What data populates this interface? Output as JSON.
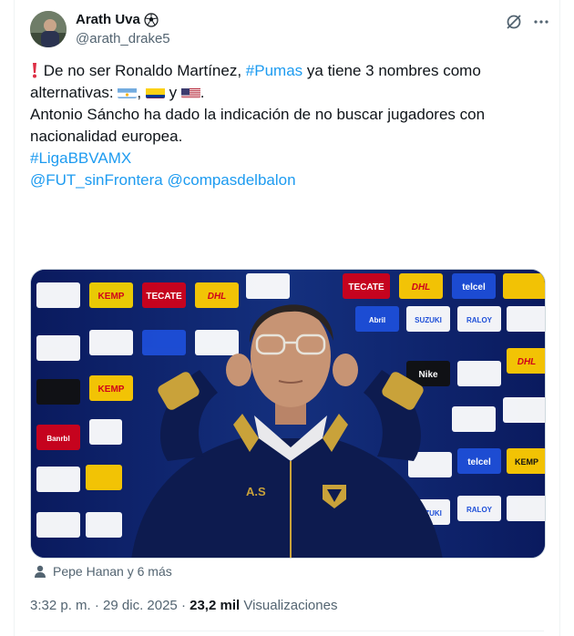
{
  "author": {
    "name": "Arath Uva",
    "handle": "@arath_drake5",
    "badge_icon": "soccer-ball-icon"
  },
  "header_icons": [
    "grok-icon",
    "more-icon"
  ],
  "tweet": {
    "line1_pre": "De no ser Ronaldo Martínez, ",
    "line1_hashtag": "#Pumas",
    "line1_post": " ya tiene 3 nombres como",
    "line2_pre": "alternativas: ",
    "line2_sep1": ", ",
    "line2_sep2": " y ",
    "line2_end": ".",
    "line3": "Antonio Sáncho ha dado la indicación de no buscar jugadores con",
    "line4": "nacionalidad europea.",
    "hashtag2": "#LigaBBVAMX",
    "mention1": "@FUT_sinFrontera",
    "mention2": "@compasdelbalon",
    "flags": [
      "argentina-flag",
      "colombia-flag",
      "usa-flag"
    ],
    "warning_icon": "red-exclamation-icon"
  },
  "media": {
    "jacket_initials": "A.S",
    "sponsor_logos": [
      "DHL",
      "telcel",
      "TECATE",
      "KEMP",
      "SUZUKI",
      "RALOY",
      "Abril",
      "Nike",
      "Banrbl"
    ]
  },
  "tagged": {
    "text": "Pepe Hanan y 6 más"
  },
  "meta": {
    "time": "3:32 p. m.",
    "sep1": " · ",
    "date": "29 dic. 2025",
    "sep2": " · ",
    "views_count": "23,2 mil",
    "views_label": " Visualizaciones"
  },
  "colors": {
    "link": "#1d9bf0",
    "text": "#0f1419",
    "secondary": "#536471",
    "backdrop": "#0b1f6b"
  }
}
